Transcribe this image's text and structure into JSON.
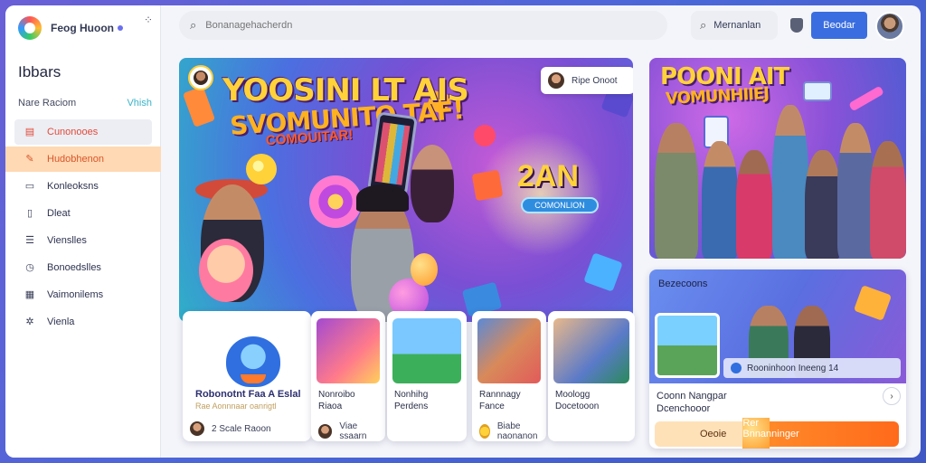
{
  "brand": {
    "name": "Feog Huoon"
  },
  "sidebar": {
    "title": "Ibbars",
    "subtitle": "Nare Raciom",
    "subtitle_hint": "Vhish",
    "items": [
      {
        "label": "Cunonooes",
        "icon": "calendar-icon"
      },
      {
        "label": "Hudobhenon",
        "icon": "brush-icon"
      },
      {
        "label": "Konleoksns",
        "icon": "window-icon"
      },
      {
        "label": "Dleat",
        "icon": "document-icon"
      },
      {
        "label": "Vienslles",
        "icon": "list-icon"
      },
      {
        "label": "Bonoedslles",
        "icon": "clock-icon"
      },
      {
        "label": "Vaimonilems",
        "icon": "table-icon"
      },
      {
        "label": "Vienla",
        "icon": "spinner-icon"
      }
    ]
  },
  "header": {
    "search_placeholder": "Bonanagehacherdn",
    "search2_label": "Mernanlan",
    "signin_label": "Beodar"
  },
  "hero": {
    "title_line1": "YOOSINI LT AIS",
    "title_line2": "SVOMUNITO TAF!",
    "title_line3": "COMOUITAR!",
    "pill_label": "Ripe Onoot",
    "number": "2AN",
    "tag": "COMONLION"
  },
  "cards": [
    {
      "title": "Robonotnt Faa A Eslal",
      "subtitle": "Rae Aonnnaar oanrigtl",
      "meta": "2 Scale Raoon"
    },
    {
      "title": "Nonroibo",
      "subtitle": "Riaoa",
      "meta": "Viae ssaarn"
    },
    {
      "title": "Nonhihg",
      "subtitle": "Perdens",
      "meta": ""
    },
    {
      "title": "Rannnagy",
      "subtitle": "Fance",
      "meta": "Biabe naonanon"
    },
    {
      "title": "Moologg",
      "subtitle": "Docetooon",
      "meta": ""
    }
  ],
  "right_banner": {
    "title_line1": "POONI AIT",
    "title_line2": "VOMUNHIIEJ"
  },
  "right_card": {
    "label": "Bezecoons",
    "caption": "Rooninhoon Ineeng 14",
    "title": "Coonn Nangpar",
    "subtitle": "Dcenchooor",
    "button_left": "Oeoie",
    "button_right": "Rer Bnnanninger"
  },
  "colors": {
    "accent": "#3a6ee0",
    "highlight": "#ffd9b3",
    "hero_purple": "#7a4fd4"
  }
}
